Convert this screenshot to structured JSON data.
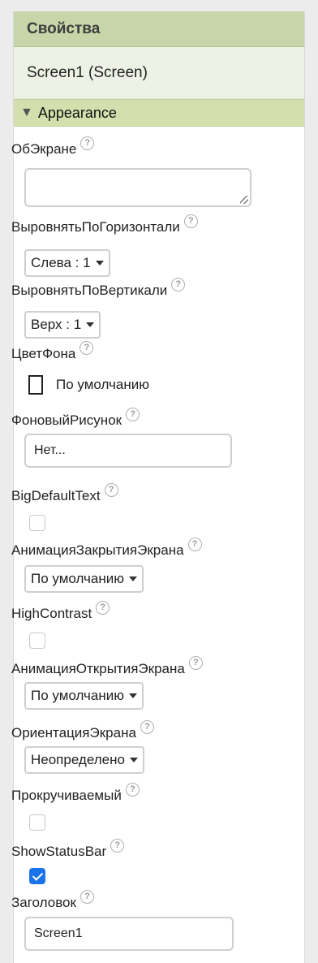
{
  "panel": {
    "title": "Свойства",
    "component": "Screen1 (Screen)",
    "section": "Appearance"
  },
  "help_glyph": "?",
  "props": {
    "about_screen": {
      "label": "ОбЭкране",
      "value": ""
    },
    "align_horizontal": {
      "label": "ВыровнятьПоГоризонтали",
      "value": "Слева : 1"
    },
    "align_vertical": {
      "label": "ВыровнятьПоВертикали",
      "value": "Верх : 1"
    },
    "background_color": {
      "label": "ЦветФона",
      "value": "По умолчанию",
      "swatch_color": "#ffffff"
    },
    "background_image": {
      "label": "ФоновыйРисунок",
      "value": "Нет..."
    },
    "big_default_text": {
      "label": "BigDefaultText",
      "checked": false
    },
    "close_animation": {
      "label": "АнимацияЗакрытияЭкрана",
      "value": "По умолчанию"
    },
    "high_contrast": {
      "label": "HighContrast",
      "checked": false
    },
    "open_animation": {
      "label": "АнимацияОткрытияЭкрана",
      "value": "По умолчанию"
    },
    "screen_orientation": {
      "label": "ОриентацияЭкрана",
      "value": "Неопределено"
    },
    "scrollable": {
      "label": "Прокручиваемый",
      "checked": false
    },
    "show_status_bar": {
      "label": "ShowStatusBar",
      "checked": true
    },
    "title": {
      "label": "Заголовок",
      "value": "Screen1"
    }
  },
  "colors": {
    "header_bg": "#c6d6a8",
    "section_bg": "#d3e0ae",
    "checkbox_checked": "#1a73e8"
  }
}
